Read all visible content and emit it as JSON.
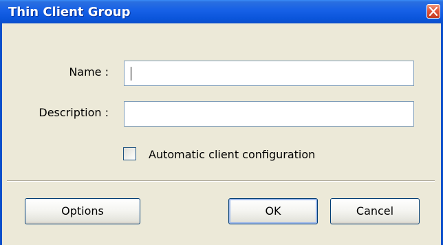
{
  "window": {
    "title": "Thin Client Group"
  },
  "form": {
    "name_label": "Name :",
    "name_value": "",
    "description_label": "Description :",
    "description_value": "",
    "auto_config_label": "Automatic client configuration",
    "auto_config_checked": false
  },
  "buttons": {
    "options": "Options",
    "ok": "OK",
    "cancel": "Cancel"
  },
  "colors": {
    "titlebar": "#0A55DB",
    "window_bg": "#ECE9D8",
    "close_button": "#E3553A"
  },
  "icons": {
    "close": "close-icon"
  }
}
